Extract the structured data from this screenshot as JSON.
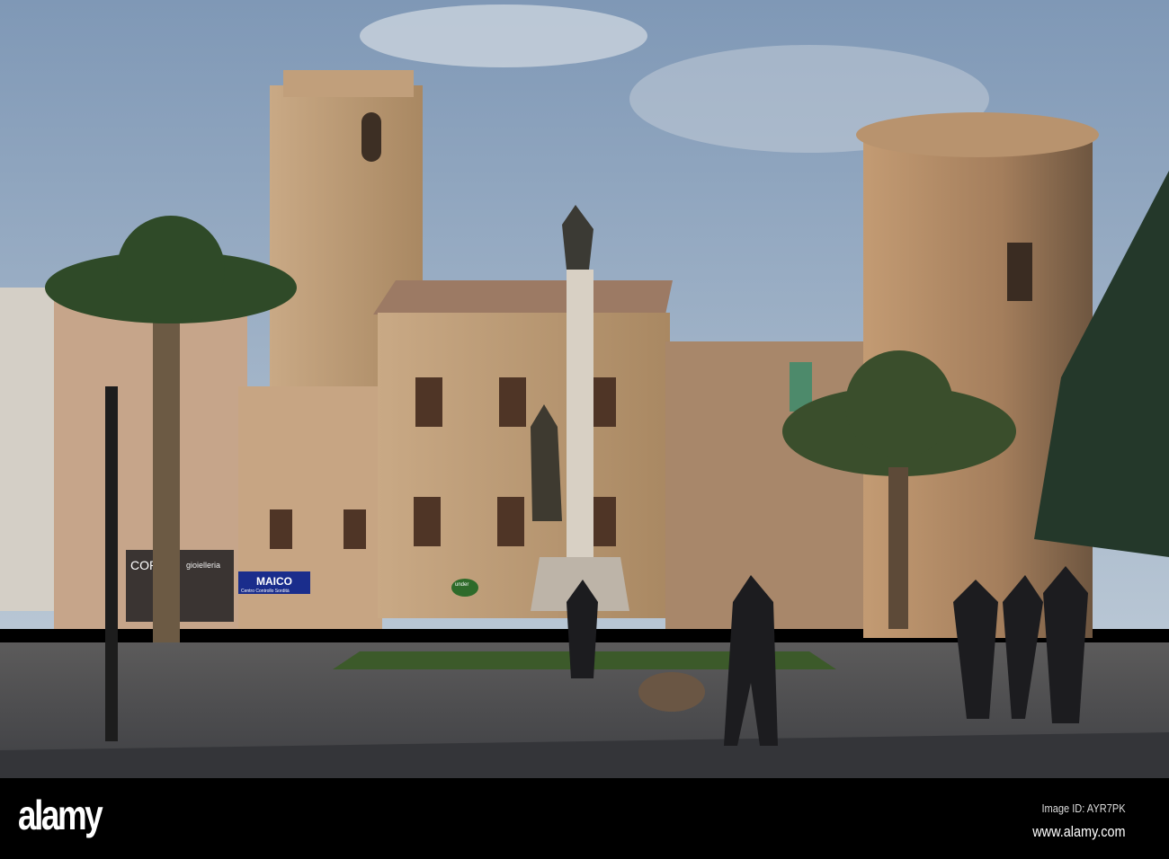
{
  "photo": {
    "signs": {
      "corvi": "CORVI",
      "gioielleria": "gioielleria",
      "maico": "MAICO",
      "maico_sub": "Centro Controllo Sordità",
      "under": "under"
    }
  },
  "footer": {
    "logo": "alamy",
    "image_id": "Image ID: AYR7PK",
    "website": "www.alamy.com"
  },
  "colors": {
    "sky": "#8fa6bf",
    "stone": "#b89a78",
    "plaza": "#4a4b4e"
  }
}
